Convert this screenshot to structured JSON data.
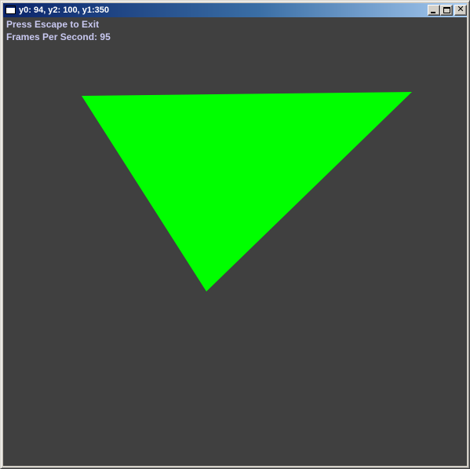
{
  "window": {
    "title": "y0: 94, y2: 100, y1:350",
    "buttons": {
      "minimize_icon": "minimize-icon",
      "maximize_icon": "maximize-icon",
      "close_icon": "close-icon",
      "close_glyph": "✕"
    }
  },
  "overlay": {
    "instruction": "Press Escape to Exit",
    "fps_label": "Frames Per Second:",
    "fps_value": "95"
  },
  "scene": {
    "background_color": "#404040",
    "triangle_color": "#00ff00"
  }
}
